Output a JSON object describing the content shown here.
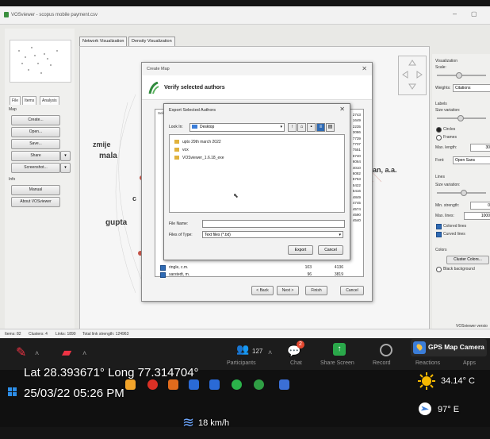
{
  "app": {
    "title": "VOSviewer - scopus mobile payment.csv"
  },
  "left_panel": {
    "tabs": [
      "File",
      "Items",
      "Analysis"
    ],
    "map_section": "Map",
    "buttons": [
      "Create...",
      "Open...",
      "Save...",
      "Share",
      "Screenshot..."
    ],
    "info_section": "Info",
    "info_buttons": [
      "Manual",
      "About VOSviewer"
    ]
  },
  "main_tabs": [
    "Network Visualization",
    "Density Visualization"
  ],
  "network_labels": {
    "a": "zmije",
    "b": "mala",
    "c": "c",
    "d": "gupta",
    "e": "wan, a.a."
  },
  "right_panel": {
    "visualization": "Visualization",
    "scale": "Scale:",
    "weights_label": "Weights:",
    "weights_value": "Citations",
    "labels": "Labels",
    "size_variation": "Size variation:",
    "circles": "Circles",
    "frames": "Frames",
    "max_length_label": "Max. length:",
    "max_length_value": "30",
    "font_label": "Font:",
    "font_value": "Open Sans",
    "lines": "Lines",
    "lines_size_variation": "Size variation:",
    "min_strength_label": "Min. strength:",
    "min_strength_value": "0",
    "max_lines_label": "Max. lines:",
    "max_lines_value": "1000",
    "colored_lines": "Colored lines",
    "curved_lines": "Curved lines",
    "colors": "Colors",
    "cluster_colors": "Cluster Colors...",
    "black_background": "Black background",
    "version": "VOSviewer versio"
  },
  "status_bar": {
    "items": "Items: 82",
    "clusters": "Clusters: 4",
    "links": "Links: 1890",
    "total_link_strength": "Total link strength: 124963"
  },
  "create_map_dialog": {
    "title": "Create Map",
    "heading": "Verify selected authors",
    "col_select": "Selec",
    "rows": [
      {
        "name": "ringle, c.m.",
        "a": "103",
        "b": "4136"
      },
      {
        "name": "sarstedt, m.",
        "a": "96",
        "b": "3819"
      }
    ],
    "right_numbers": [
      "2743",
      "1649",
      "2235",
      "3086",
      "7739",
      "7737",
      "7551",
      "6740",
      "6064",
      "4010",
      "6082",
      "5753",
      "5422",
      "5416",
      "4849",
      "4745",
      "4574",
      "4590",
      "4540"
    ],
    "back": "< Back",
    "next": "Next >",
    "finish": "Finish",
    "cancel": "Cancel"
  },
  "export_dialog": {
    "title": "Export Selected Authors",
    "look_in_label": "Look In:",
    "look_in_value": "Desktop",
    "files": [
      "upto 29th march 2022",
      "vox",
      "VOSviewer_1.6.18_exe"
    ],
    "file_name_label": "File Name:",
    "file_name_value": "",
    "file_type_label": "Files of Type:",
    "file_type_value": "Text files (*.txt)",
    "export": "Export",
    "cancel": "Cancel"
  },
  "zoom_bar": {
    "participants_count": "127",
    "participants": "Participants",
    "chat": "Chat",
    "chat_badge": "2",
    "share_screen": "Share Screen",
    "record": "Record",
    "reactions": "Reactions",
    "apps": "Apps"
  },
  "gps_overlay": {
    "badge": "GPS Map Camera",
    "coords": "Lat 28.393671° Long 77.314704°",
    "datetime": "25/03/22 05:26 PM",
    "temperature": "34.14° C",
    "heading": "97° E",
    "wind": "18 km/h"
  },
  "colors": {
    "sun": "#f5b800",
    "chat_badge": "#e4472f",
    "share_green": "#2aa84a",
    "checkbox_blue": "#2e6ab4"
  }
}
